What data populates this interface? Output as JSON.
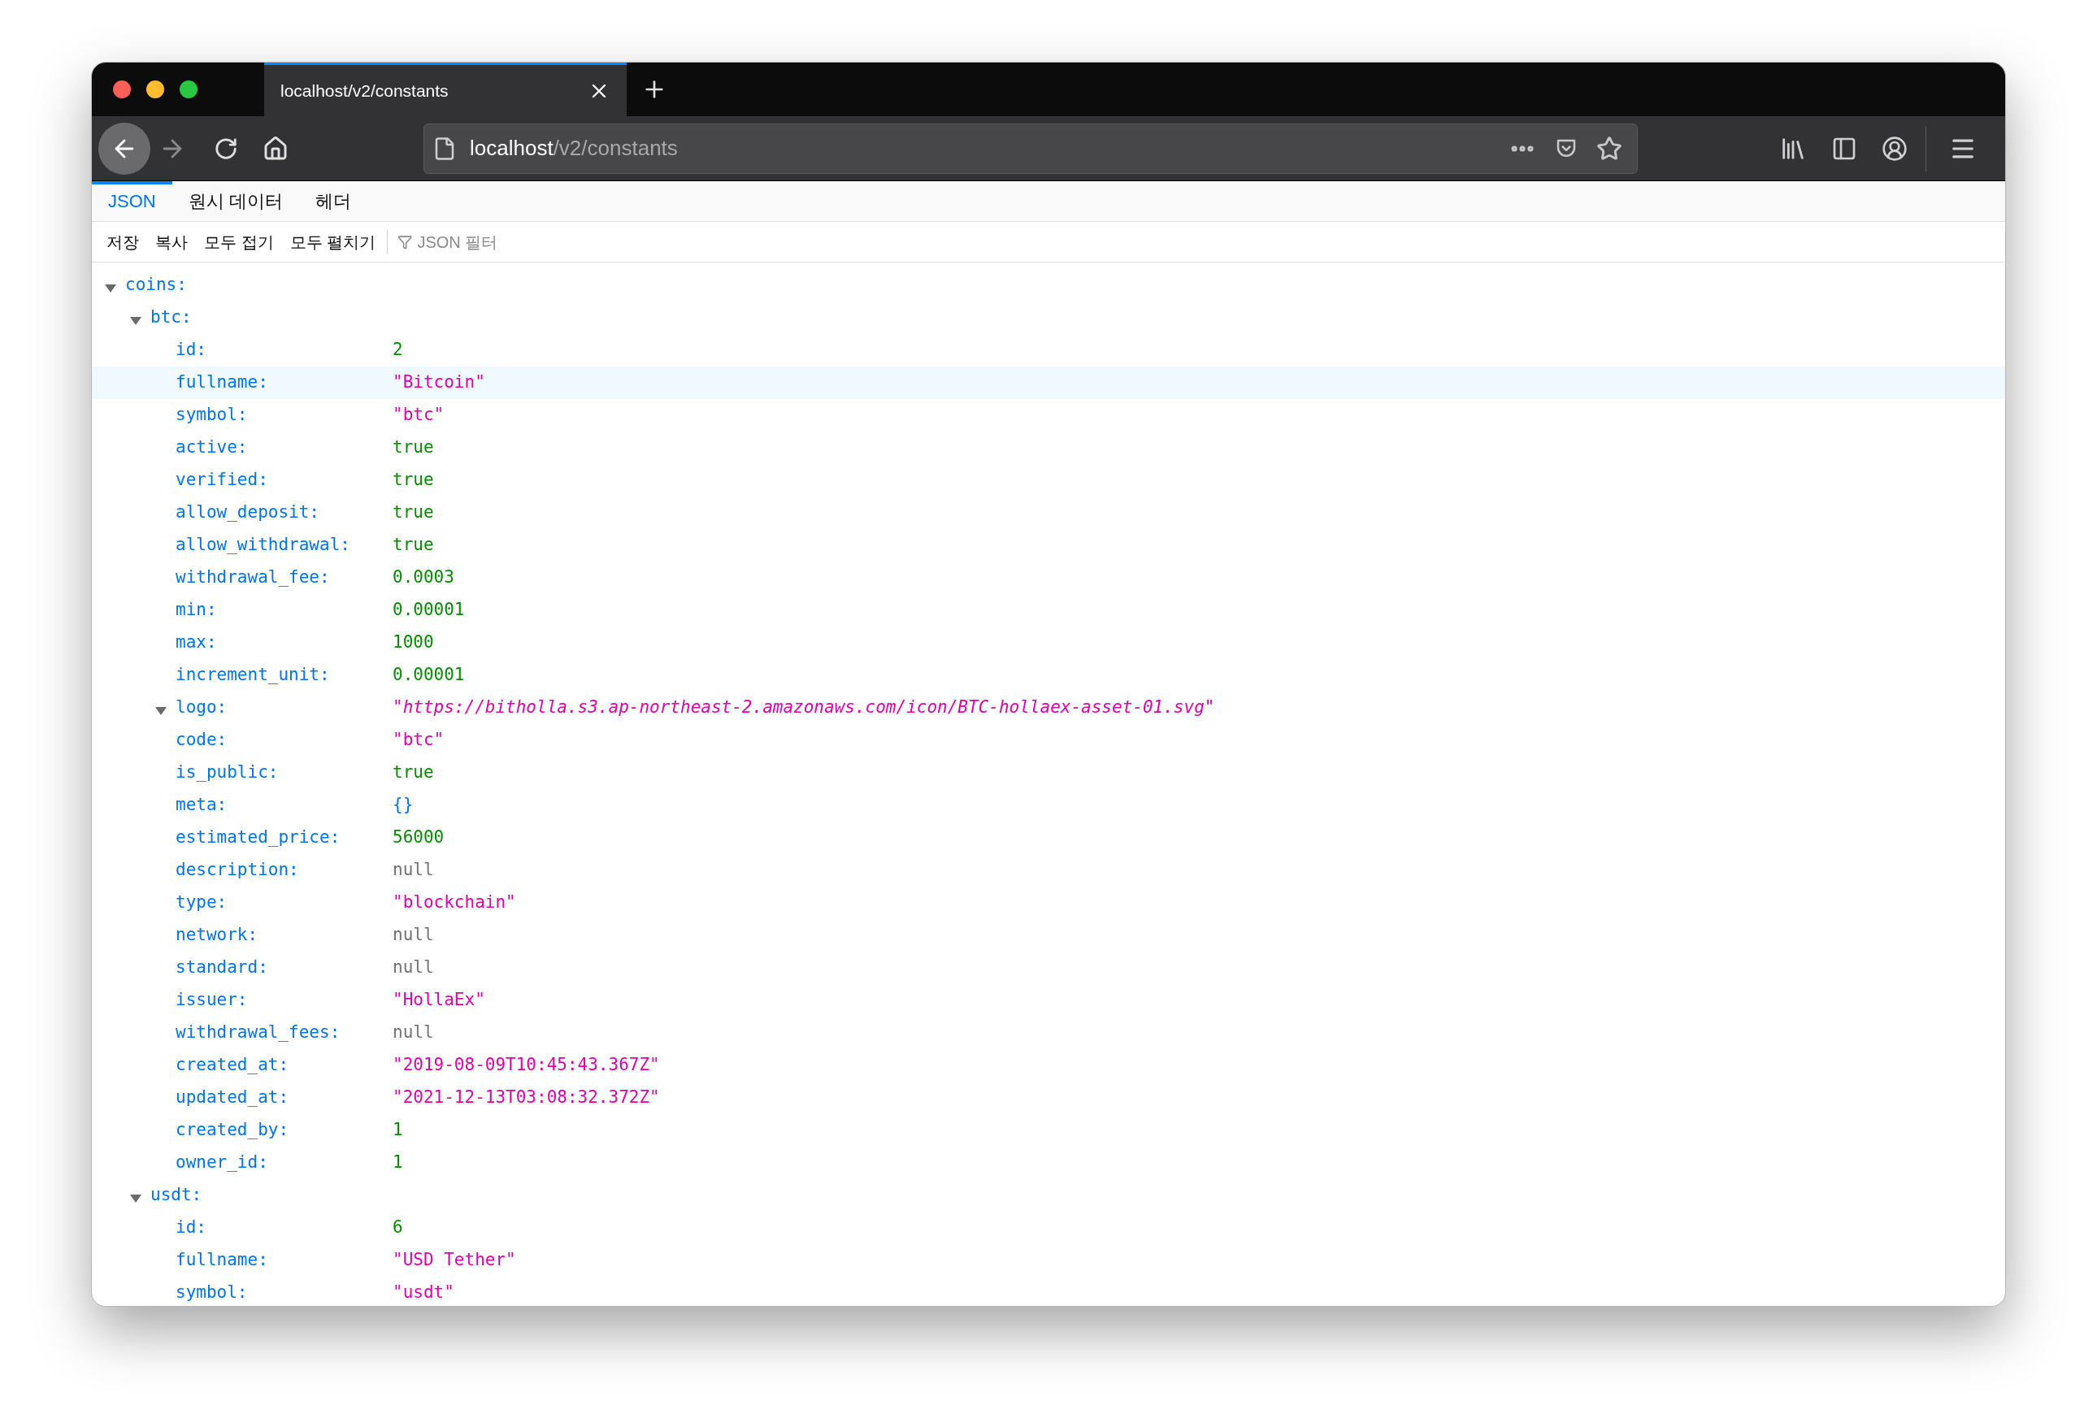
{
  "browser_tab": {
    "title": "localhost/v2/constants",
    "selected": true
  },
  "address_bar": {
    "host": "localhost",
    "path": "/v2/constants"
  },
  "viewer_tabs": [
    {
      "label": "JSON",
      "selected": true
    },
    {
      "label": "원시 데이터",
      "selected": false
    },
    {
      "label": "헤더",
      "selected": false
    }
  ],
  "viewer_toolbar": {
    "buttons": [
      "저장",
      "복사",
      "모두 접기",
      "모두 펼치기"
    ],
    "filter": {
      "placeholder": "JSON 필터"
    }
  },
  "rows": [
    {
      "key": "coins:",
      "expanded": true,
      "selected": false,
      "children": [
        {
          "key": "btc:",
          "expanded": true,
          "selected": false,
          "children": [
            {
              "key": "id:",
              "value": "2",
              "kind": "number",
              "selected": false
            },
            {
              "key": "fullname:",
              "value": "\"Bitcoin\"",
              "kind": "string",
              "selected": true
            },
            {
              "key": "symbol:",
              "value": "\"btc\"",
              "kind": "string",
              "selected": false
            },
            {
              "key": "active:",
              "value": "true",
              "kind": "number",
              "selected": false
            },
            {
              "key": "verified:",
              "value": "true",
              "kind": "number",
              "selected": false
            },
            {
              "key": "allow_deposit:",
              "value": "true",
              "kind": "number",
              "selected": false
            },
            {
              "key": "allow_withdrawal:",
              "value": "true",
              "kind": "number",
              "selected": false
            },
            {
              "key": "withdrawal_fee:",
              "value": "0.0003",
              "kind": "number",
              "selected": false
            },
            {
              "key": "min:",
              "value": "0.00001",
              "kind": "number",
              "selected": false
            },
            {
              "key": "max:",
              "value": "1000",
              "kind": "number",
              "selected": false
            },
            {
              "key": "increment_unit:",
              "value": "0.00001",
              "kind": "number",
              "selected": false
            },
            {
              "key": "logo:",
              "value": "\"https://bitholla.s3.ap-northeast-2.amazonaws.com/icon/BTC-hollaex-asset-01.svg\"",
              "kind": "link",
              "expanded": true,
              "selected": false
            },
            {
              "key": "code:",
              "value": "\"btc\"",
              "kind": "string",
              "selected": false
            },
            {
              "key": "is_public:",
              "value": "true",
              "kind": "number",
              "selected": false
            },
            {
              "key": "meta:",
              "value": "{}",
              "kind": "object",
              "selected": false
            },
            {
              "key": "estimated_price:",
              "value": "56000",
              "kind": "number",
              "selected": false
            },
            {
              "key": "description:",
              "value": "null",
              "kind": "null",
              "selected": false
            },
            {
              "key": "type:",
              "value": "\"blockchain\"",
              "kind": "string",
              "selected": false
            },
            {
              "key": "network:",
              "value": "null",
              "kind": "null",
              "selected": false
            },
            {
              "key": "standard:",
              "value": "null",
              "kind": "null",
              "selected": false
            },
            {
              "key": "issuer:",
              "value": "\"HollaEx\"",
              "kind": "string",
              "selected": false
            },
            {
              "key": "withdrawal_fees:",
              "value": "null",
              "kind": "null",
              "selected": false
            },
            {
              "key": "created_at:",
              "value": "\"2019-08-09T10:45:43.367Z\"",
              "kind": "string",
              "selected": false
            },
            {
              "key": "updated_at:",
              "value": "\"2021-12-13T03:08:32.372Z\"",
              "kind": "string",
              "selected": false
            },
            {
              "key": "created_by:",
              "value": "1",
              "kind": "number",
              "selected": false
            },
            {
              "key": "owner_id:",
              "value": "1",
              "kind": "number",
              "selected": false
            }
          ]
        },
        {
          "key": "usdt:",
          "expanded": true,
          "selected": false,
          "children": [
            {
              "key": "id:",
              "value": "6",
              "kind": "number",
              "selected": false
            },
            {
              "key": "fullname:",
              "value": "\"USD Tether\"",
              "kind": "string",
              "selected": false
            },
            {
              "key": "symbol:",
              "value": "\"usdt\"",
              "kind": "string",
              "selected": false
            }
          ]
        }
      ]
    }
  ]
}
